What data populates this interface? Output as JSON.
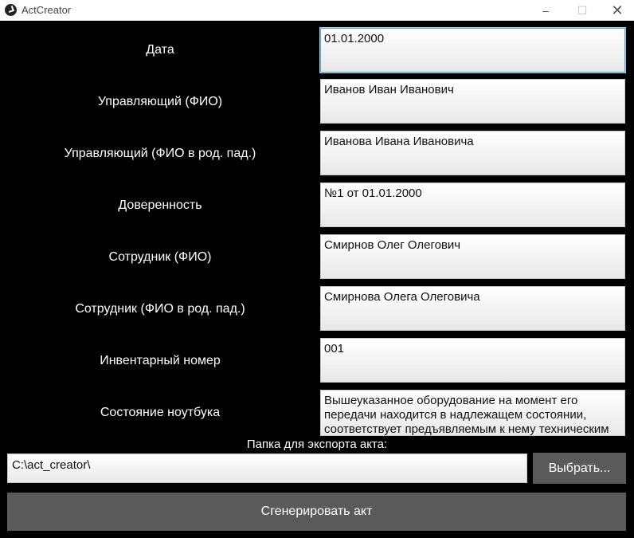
{
  "window": {
    "title": "ActCreator",
    "minimize": "–",
    "maximize": "☐",
    "close": "✕"
  },
  "form": {
    "rows": [
      {
        "label": "Дата",
        "value": "01.01.2000"
      },
      {
        "label": "Управляющий (ФИО)",
        "value": "Иванов Иван Иванович"
      },
      {
        "label": "Управляющий (ФИО в род. пад.)",
        "value": "Иванова Ивана Ивановича"
      },
      {
        "label": "Доверенность",
        "value": "№1 от 01.01.2000"
      },
      {
        "label": "Сотрудник (ФИО)",
        "value": "Смирнов Олег Олегович"
      },
      {
        "label": "Сотрудник (ФИО в род. пад.)",
        "value": "Смирнова Олега Олеговича"
      },
      {
        "label": "Инвентарный номер",
        "value": "001"
      },
      {
        "label": "Состояние ноутбука",
        "value": "Вышеуказанное оборудование на момент его передачи находится в надлежащем состоянии, соответствует предъявляемым к нему техническим"
      }
    ]
  },
  "export": {
    "label": "Папка для экспорта акта:",
    "path": "C:\\act_creator\\",
    "choose_label": "Выбрать..."
  },
  "generate_label": "Сгенерировать акт"
}
